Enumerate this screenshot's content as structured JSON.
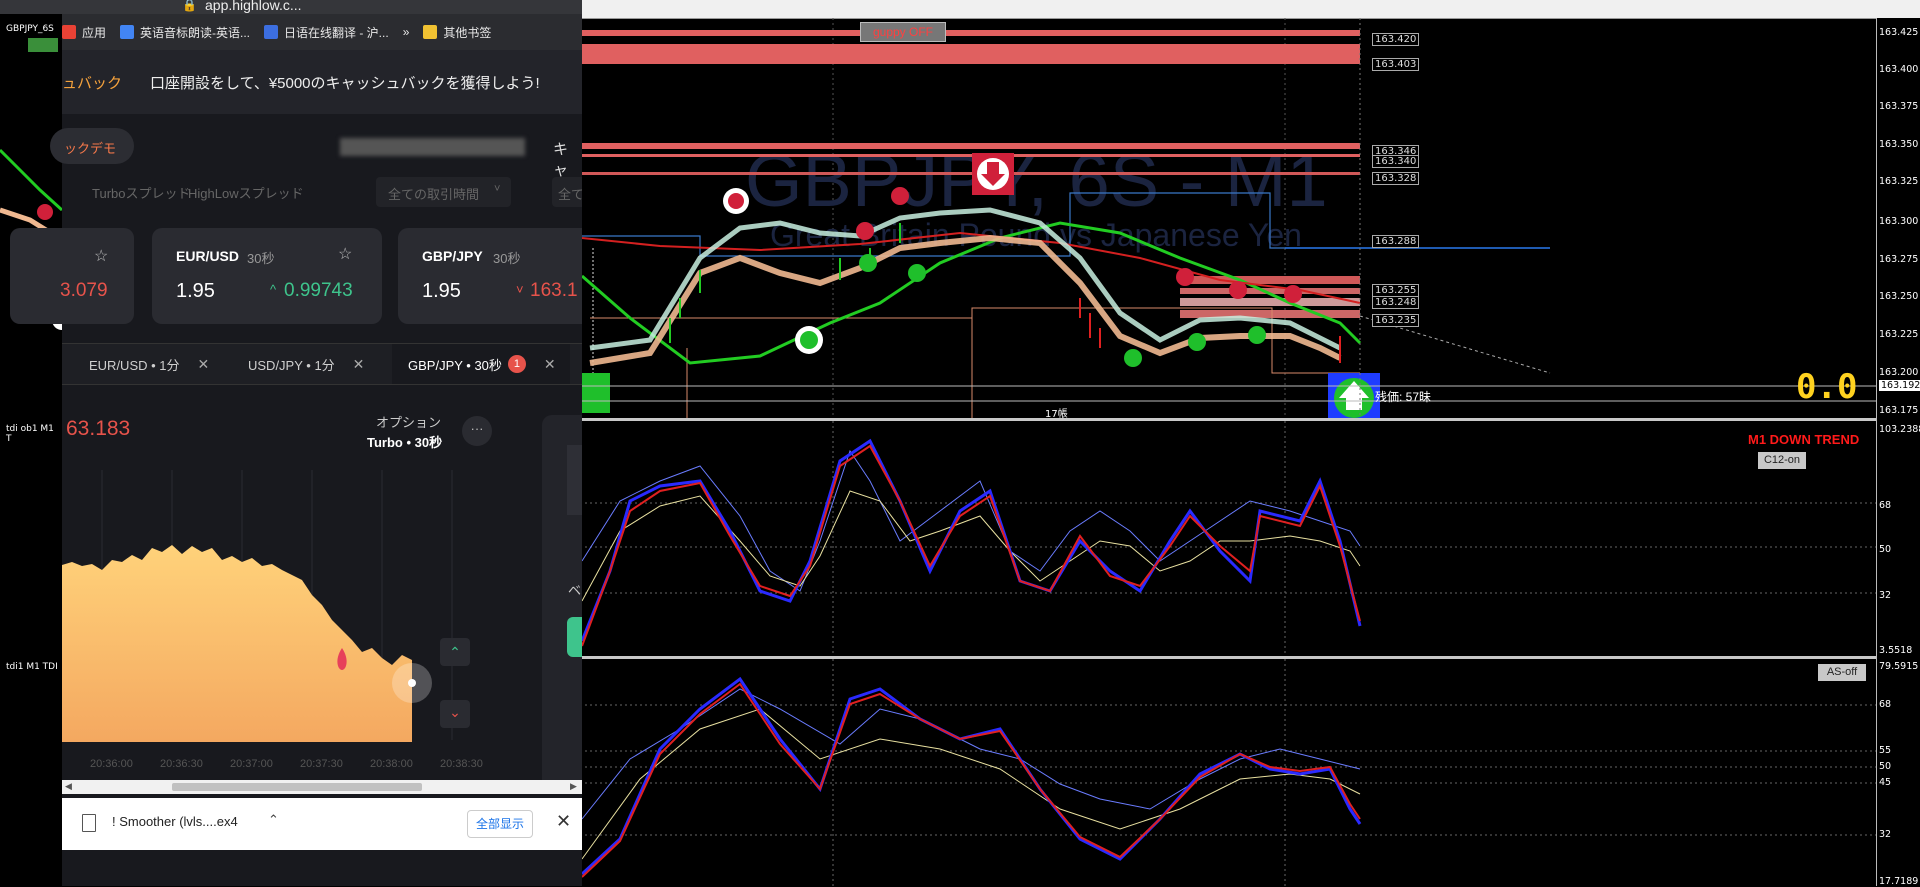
{
  "browser": {
    "address": "app.highlow.c...",
    "bookmarks": [
      {
        "label": "应用",
        "color": "#e94235"
      },
      {
        "label": "英语音标朗读-英语...",
        "color": "#4285f4"
      },
      {
        "label": "日语在线翻译 - 沪...",
        "color": "#3c6ee0"
      },
      {
        "label": "»",
        "color": ""
      },
      {
        "label": "其他书签",
        "color": "#f1c232"
      }
    ],
    "promo_left": "ュバック",
    "promo_text": "口座開設をして、¥5000のキャッシュバックを獲得しよう!",
    "demo_pill": "ックデモ",
    "demo_right": "キャ",
    "filters": {
      "turbo_spread": "Turboスプレッド",
      "highlow_spread": "HighLowスプレッド",
      "all_time": "全ての取引時間",
      "all_right": "全て"
    },
    "cards": [
      {
        "pair": "",
        "duration": "",
        "payout": "",
        "rate": "3.079",
        "rate_color": "#e7534b"
      },
      {
        "pair": "EUR/USD",
        "duration": "30秒",
        "payout": "1.95",
        "rate": "0.99743",
        "rate_arrow": "^",
        "rate_color": "#3ec48c"
      },
      {
        "pair": "GBP/JPY",
        "duration": "30秒",
        "payout": "1.95",
        "rate": "163.1",
        "rate_arrow": "˅",
        "rate_color": "#e7534b"
      }
    ],
    "tabs": [
      {
        "label": "EUR/USD • 1分"
      },
      {
        "label": "USD/JPY • 1分"
      },
      {
        "label": "GBP/JPY • 30秒",
        "badge": "1"
      }
    ],
    "chart": {
      "price": "63.183",
      "option_label": "オプション",
      "option_type": "Turbo • 30秒",
      "more": "···",
      "times": [
        "20:36:00",
        "20:36:30",
        "20:37:00",
        "20:37:30",
        "20:38:00",
        "20:38:30"
      ],
      "side_label": "ベ"
    },
    "download": {
      "file": "! Smoother (lvls....ex4",
      "show_all": "全部显示"
    }
  },
  "mt4": {
    "symbol_label": "GBPJPY_6S",
    "watermark_title": "GBPJPY, 6S - M1",
    "watermark_sub": "Great Britain Pound vs Japanese Yen",
    "guppy_button": "guppy OFF",
    "level_labels": [
      "163.420",
      "163.403",
      "163.346",
      "163.340",
      "163.328",
      "163.288",
      "163.255",
      "163.248",
      "163.235"
    ],
    "price_scale": [
      "163.425",
      "163.400",
      "163.375",
      "163.350",
      "163.325",
      "163.300",
      "163.275",
      "163.250",
      "163.225",
      "163.200",
      "163.192",
      "163.175"
    ],
    "candle_count": "17帳",
    "remaining": "残価: 57昧",
    "big_numbers": "0.0",
    "panel1": {
      "title": "tdi ob1 M1 T",
      "trend": "M1 DOWN TREND",
      "button": "C12-on",
      "scale": [
        "103.2388",
        "68",
        "50",
        "32",
        "3.5518"
      ]
    },
    "panel2": {
      "title": "tdi1 M1 TDI",
      "button": "AS-off",
      "scale": [
        "79.5915",
        "68",
        "55",
        "50",
        "45",
        "32",
        "17.7189"
      ]
    },
    "colors": {
      "up": "#1fbf2b",
      "down": "#d0203a",
      "red_line": "#d42020",
      "blue_line": "#2a2aff"
    }
  }
}
